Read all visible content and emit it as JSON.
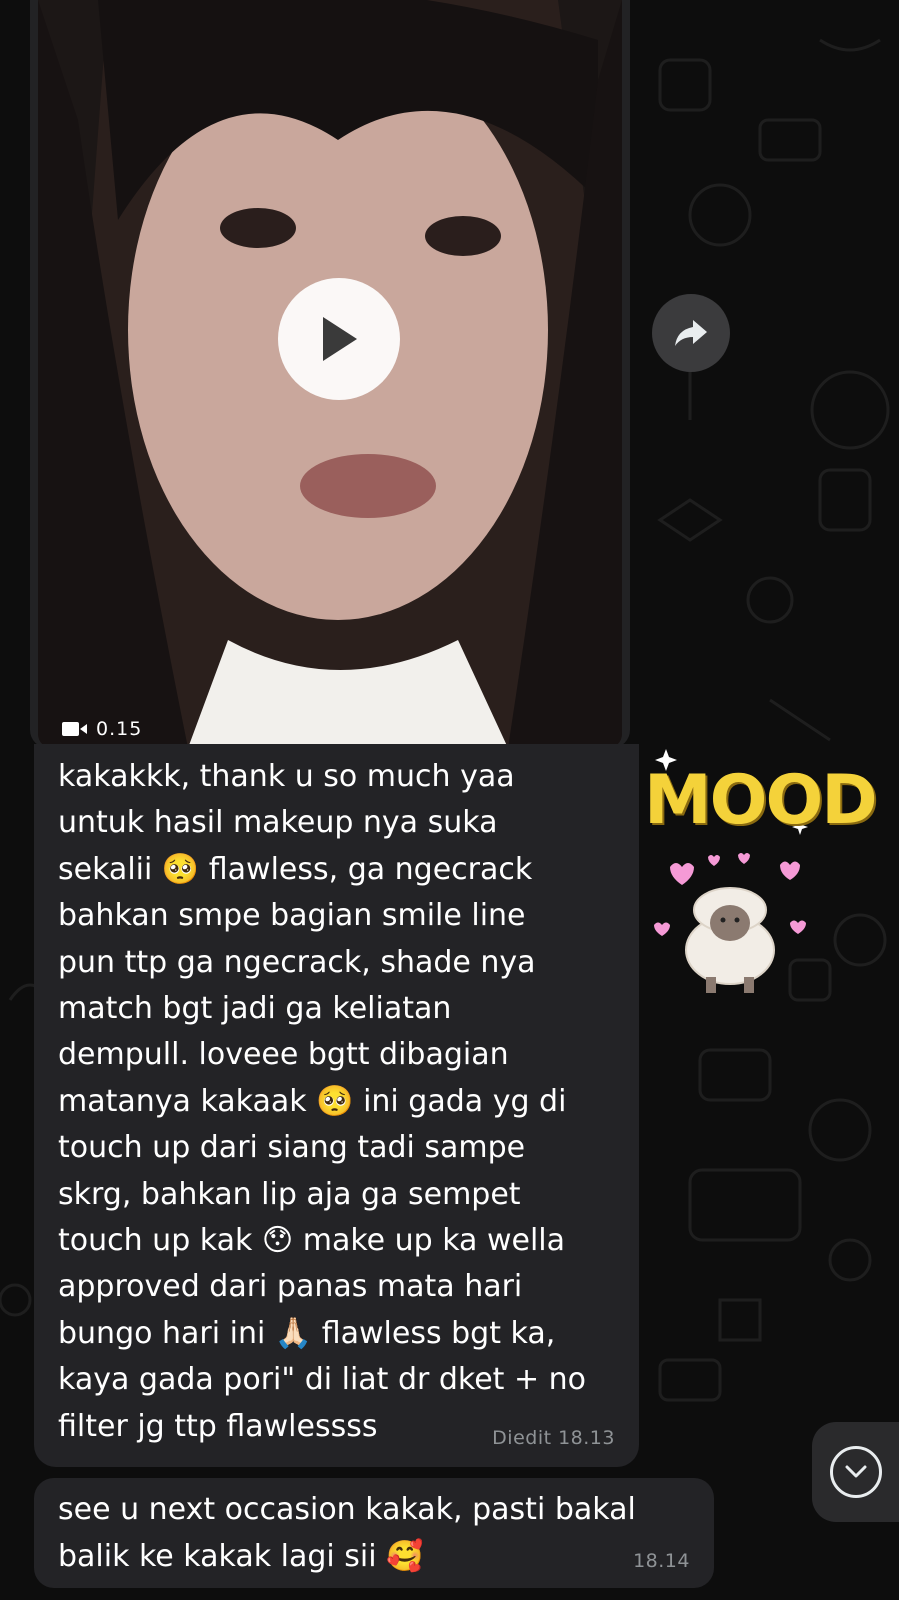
{
  "video": {
    "duration": "0.15",
    "play_icon": "play-icon",
    "camera_icon": "video-camera-icon"
  },
  "forward": {
    "icon": "forward-arrow-icon"
  },
  "message_1": {
    "text": "kakakkk, thank u so much yaa\nuntuk hasil makeup nya suka\nsekalii 🥺 flawless, ga ngecrack\nbahkan smpe bagian smile line\npun ttp ga ngecrack, shade nya\nmatch bgt jadi ga keliatan\ndempull. loveee bgtt dibagian\nmatanya kakaak 🥺 ini gada yg di\ntouch up dari siang tadi sampe\nskrg, bahkan lip aja ga sempet\ntouch up kak 😯 make up ka wella\napproved dari panas mata hari\nbungo hari ini 🙏🏻 flawless bgt ka,\nkaya gada pori\" di liat dr dket + no\nfilter jg ttp flawlessss",
    "edited_label": "Diedit",
    "time": "18.13"
  },
  "sticker": {
    "text": "MOOD",
    "icon": "sheep-sticker"
  },
  "message_2": {
    "text": "see u next occasion kakak, pasti bakal\nbalik ke kakak lagi sii 🥰",
    "time": "18.14"
  },
  "scroll_down": {
    "icon": "chevron-down-icon"
  },
  "colors": {
    "bubble": "#232326",
    "background": "#0b0b0b",
    "meta_text": "#8f9396",
    "mood_yellow": "#f4d23a"
  }
}
